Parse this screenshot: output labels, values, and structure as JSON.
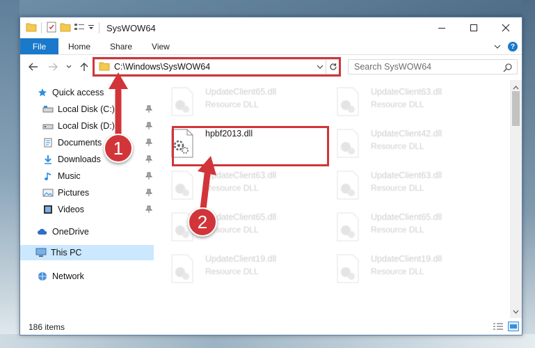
{
  "window": {
    "title": "SysWOW64",
    "controls": {
      "minimize": "minimize",
      "maximize": "maximize",
      "close": "close"
    }
  },
  "ribbon": {
    "file_tab": "File",
    "tabs": [
      "Home",
      "Share",
      "View"
    ]
  },
  "nav": {
    "address_path": "C:\\Windows\\SysWOW64",
    "search_placeholder": "Search SysWOW64"
  },
  "sidebar": {
    "quick_access": "Quick access",
    "items": [
      {
        "label": "Local Disk (C:)",
        "icon": "drive-icon"
      },
      {
        "label": "Local Disk (D:)",
        "icon": "drive-icon"
      },
      {
        "label": "Documents",
        "icon": "documents-icon"
      },
      {
        "label": "Downloads",
        "icon": "downloads-icon"
      },
      {
        "label": "Music",
        "icon": "music-icon"
      },
      {
        "label": "Pictures",
        "icon": "pictures-icon"
      },
      {
        "label": "Videos",
        "icon": "videos-icon"
      }
    ],
    "onedrive": "OneDrive",
    "this_pc": "This PC",
    "network": "Network"
  },
  "files": {
    "left_column": [
      {
        "name": "UpdateClient65.dll",
        "type": "Resource DLL"
      },
      {
        "name": "hpbf2013.dll",
        "type": ""
      },
      {
        "name": "UpdateClient63.dll",
        "type": "Resource DLL"
      },
      {
        "name": "UpdateClient65.dll",
        "type": "Resource DLL"
      },
      {
        "name": "UpdateClient19.dll",
        "type": "Resource DLL"
      }
    ],
    "right_column": [
      {
        "name": "UpdateClient63.dll",
        "type": "Resource DLL"
      },
      {
        "name": "UpdateClient42.dll",
        "type": "Resource DLL"
      },
      {
        "name": "UpdateClient63.dll",
        "type": "Resource DLL"
      },
      {
        "name": "UpdateClient65.dll",
        "type": "Resource DLL"
      },
      {
        "name": "UpdateClient19.dll",
        "type": "Resource DLL"
      }
    ]
  },
  "status": {
    "item_count": "186 items"
  },
  "annotations": {
    "step1": "1",
    "step2": "2"
  },
  "colors": {
    "accent": "#1979ca",
    "highlight": "#d1353a",
    "selected": "#cce8ff"
  }
}
